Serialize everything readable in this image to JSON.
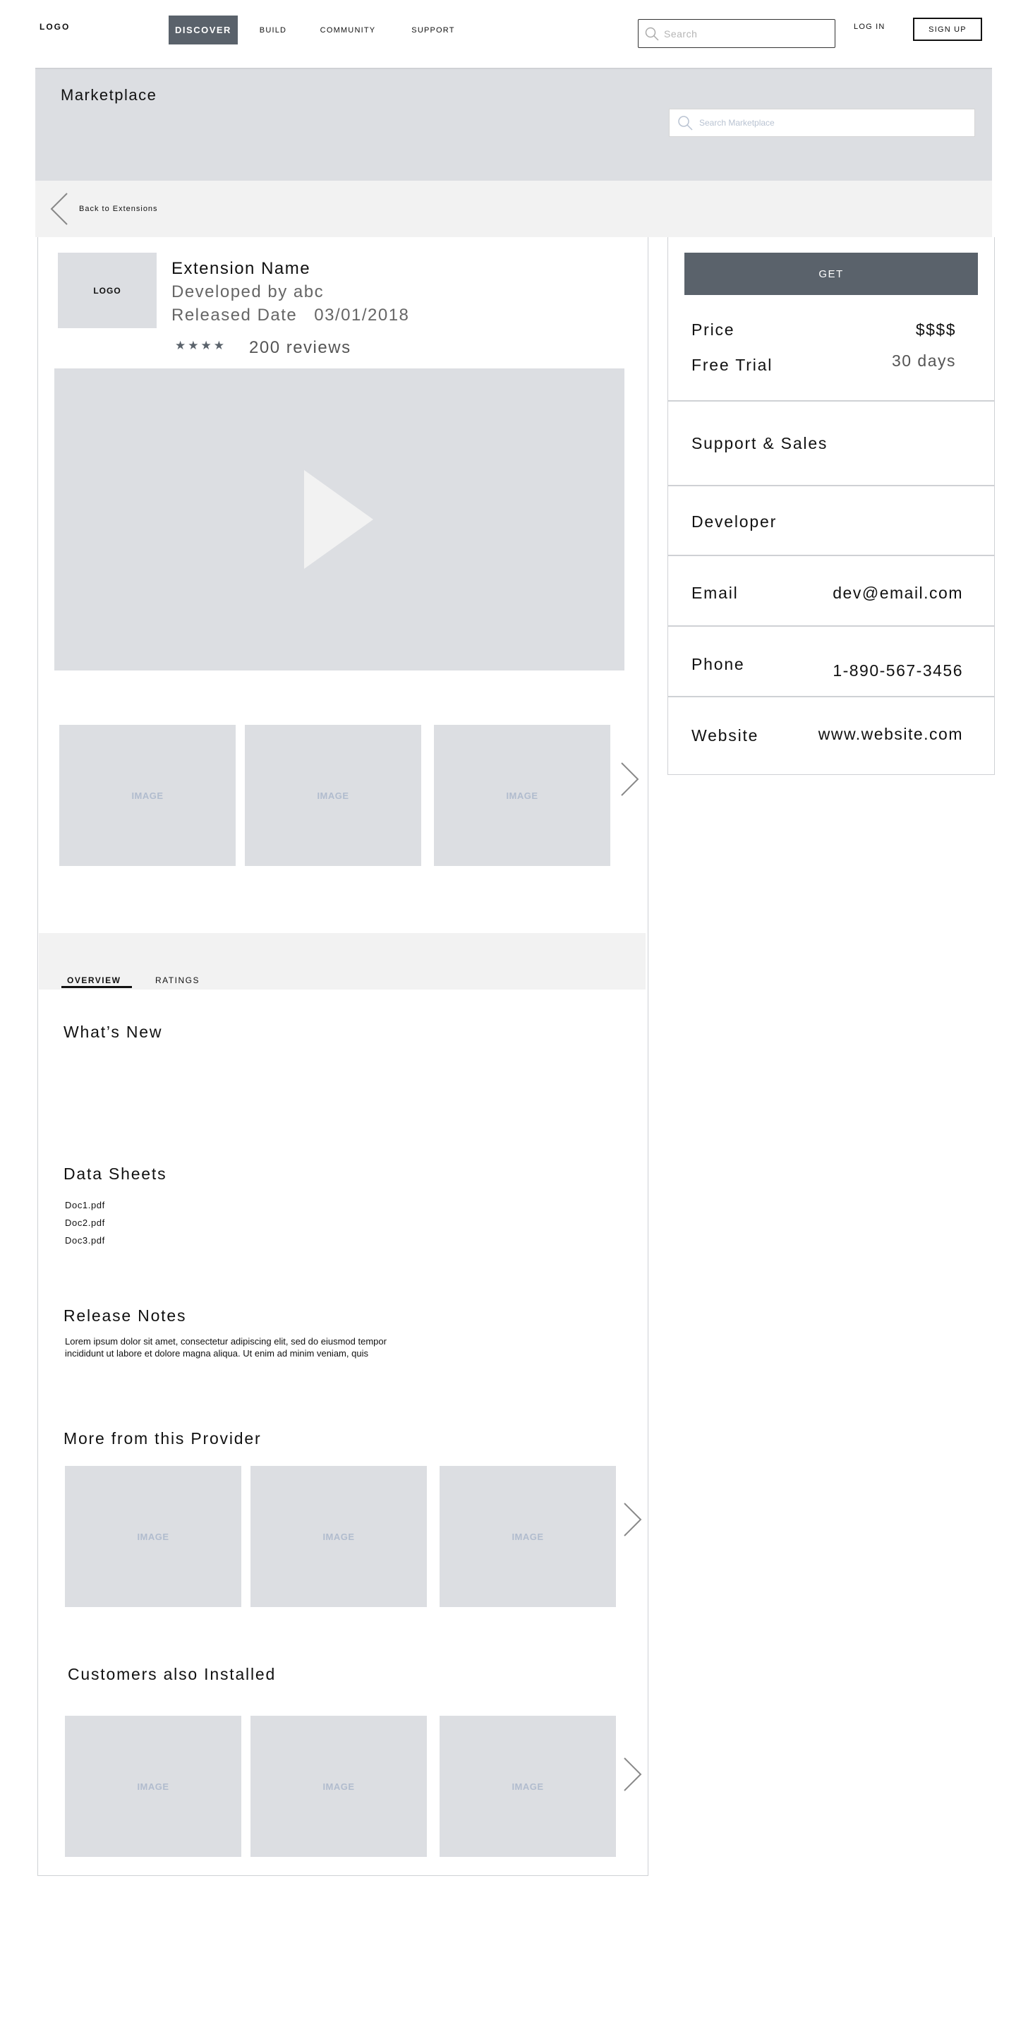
{
  "nav": {
    "logo": "LOGO",
    "items": [
      {
        "label": "DISCOVER",
        "active": true
      },
      {
        "label": "BUILD"
      },
      {
        "label": "COMMUNITY"
      },
      {
        "label": "SUPPORT"
      }
    ],
    "search_placeholder": "Search",
    "login": "LOG IN",
    "signup": "SIGN UP"
  },
  "banner": {
    "title": "Marketplace",
    "search_placeholder": "Search Marketplace"
  },
  "back": {
    "label": "Back to Extensions"
  },
  "extension": {
    "logo": "LOGO",
    "name": "Extension Name",
    "developer": "Developed by abc",
    "released_label": "Released Date",
    "released_date": "03/01/2018",
    "stars": "★★★★",
    "rating_value": 4,
    "reviews": "200 reviews"
  },
  "gallery": {
    "images": [
      "IMAGE",
      "IMAGE",
      "IMAGE"
    ]
  },
  "tabs": [
    {
      "label": "OVERVIEW",
      "active": true
    },
    {
      "label": "RATINGS"
    }
  ],
  "overview": {
    "whats_new_title": "What’s New",
    "data_sheets_title": "Data Sheets",
    "docs": [
      "Doc1.pdf",
      "Doc2.pdf",
      "Doc3.pdf"
    ],
    "release_notes_title": "Release Notes",
    "release_notes_line1": "Lorem ipsum dolor sit amet, consectetur adipiscing elit, sed do eiusmod tempor",
    "release_notes_line2": "incididunt ut labore et dolore magna aliqua. Ut enim ad minim veniam, quis",
    "more_title": "More from this Provider",
    "more_images": [
      "IMAGE",
      "IMAGE",
      "IMAGE"
    ],
    "also_title": "Customers also Installed",
    "also_images": [
      "IMAGE",
      "IMAGE",
      "IMAGE"
    ]
  },
  "sidebar": {
    "get": "GET",
    "price_label": "Price",
    "price_value": "$$$$",
    "trial_label": "Free Trial",
    "trial_value": "30 days",
    "support_title": "Support & Sales",
    "developer_label": "Developer",
    "email_label": "Email",
    "email_value": "dev@email.com",
    "phone_label": "Phone",
    "phone_value": "1-890-567-3456",
    "website_label": "Website",
    "website_value": "www.website.com"
  },
  "colors": {
    "accent": "#5a626b",
    "placeholder_bg": "#dcdee2",
    "light_bg": "#f2f2f2",
    "image_text": "#b1bcce"
  }
}
